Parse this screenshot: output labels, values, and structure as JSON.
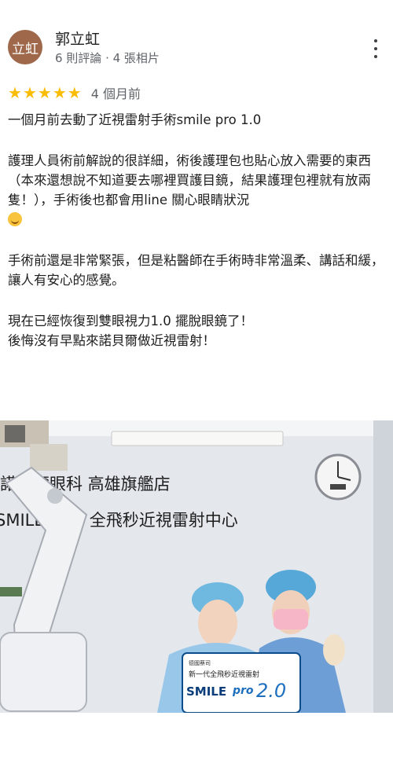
{
  "review": {
    "avatar_text": "立虹",
    "author": "郭立虹",
    "meta": "6 則評論 · 4 張相片",
    "stars": 5,
    "time_ago": "4 個月前",
    "paragraphs": [
      "一個月前去動了近視雷射手術smile pro 1.0",
      "護理人員術前解說的很詳細，術後護理包也貼心放入需要的東西（本來還想說不知道要去哪裡買護目鏡，結果護理包裡就有放兩隻！），手術後也都會用line 關心眼睛狀況",
      "手術前還是非常緊張，但是粘醫師在手術時非常溫柔、講話和緩，讓人有安心的感覺。",
      "現在已經恢復到雙眼視力1.0 擺脫眼鏡了！\n後悔沒有早點來諾貝爾做近視雷射！"
    ]
  },
  "photo": {
    "wall_line1": "諾貝爾眼科 高雄旗艦店",
    "wall_line2": "SMILE PRO 全飛秒近視雷射中心",
    "sign_small": "德國蔡司",
    "sign_sub": "新一代全飛秒近視雷射",
    "sign_smile": "SMILE",
    "sign_pro": "pro",
    "sign_ver": "2.0"
  },
  "colors": {
    "avatar_bg": "#a0684a",
    "star": "#fbbc04",
    "meta_text": "#5f6368"
  }
}
